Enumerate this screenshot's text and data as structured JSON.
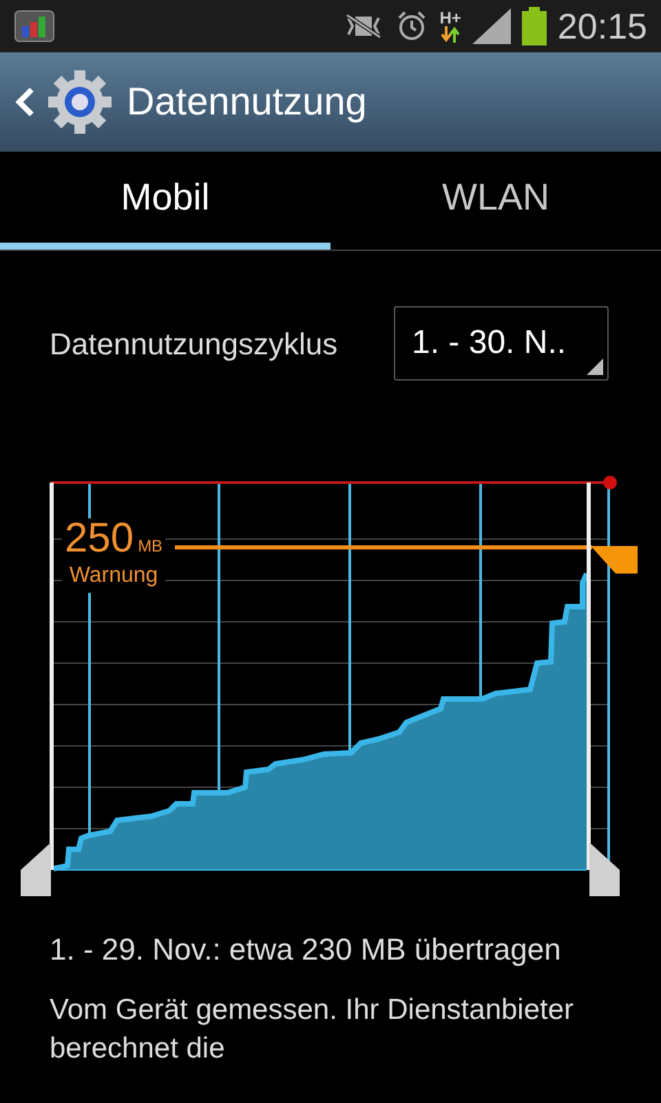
{
  "status_bar": {
    "network": "H+",
    "time": "20:15"
  },
  "action_bar": {
    "title": "Datennutzung"
  },
  "tabs": [
    {
      "label": "Mobil",
      "selected": true
    },
    {
      "label": "WLAN",
      "selected": false
    }
  ],
  "cycle": {
    "label": "Datennutzungszyklus",
    "value": "1. - 30. N.."
  },
  "chart": {
    "warning_value": "250",
    "warning_unit": "MB",
    "warning_label": "Warnung"
  },
  "summary": "1. - 29. Nov.: etwa 230 MB übertragen",
  "note": "Vom Gerät gemessen. Ihr Dienstanbieter berechnet die"
}
